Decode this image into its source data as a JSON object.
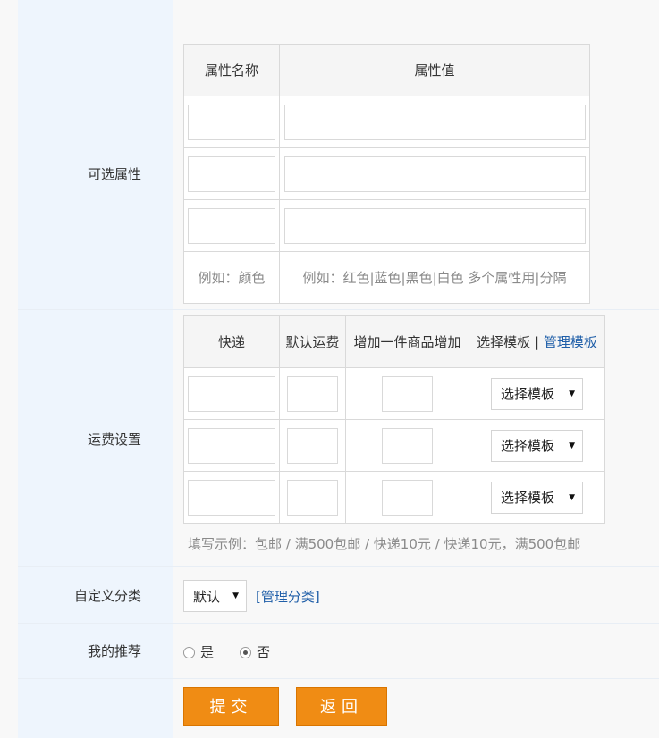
{
  "attributes": {
    "label": "可选属性",
    "header_name": "属性名称",
    "header_value": "属性值",
    "rows": [
      {
        "name": "",
        "value": ""
      },
      {
        "name": "",
        "value": ""
      },
      {
        "name": "",
        "value": ""
      }
    ],
    "example_name": "例如：颜色",
    "example_value": "例如：红色|蓝色|黑色|白色 多个属性用|分隔"
  },
  "shipping": {
    "label": "运费设置",
    "header_courier": "快递",
    "header_default_fee": "默认运费",
    "header_extra_fee": "增加一件商品增加",
    "header_template": "选择模板",
    "header_separator": "|",
    "header_manage_link": "管理模板",
    "template_select_value": "选择模板",
    "rows": [
      {
        "courier": "",
        "default_fee": "",
        "extra_fee": "",
        "template": "选择模板"
      },
      {
        "courier": "",
        "default_fee": "",
        "extra_fee": "",
        "template": "选择模板"
      },
      {
        "courier": "",
        "default_fee": "",
        "extra_fee": "",
        "template": "选择模板"
      }
    ],
    "example": "填写示例：包邮 / 满500包邮 / 快递10元 / 快递10元，满500包邮"
  },
  "category": {
    "label": "自定义分类",
    "selected": "默认",
    "manage_link": "[管理分类]"
  },
  "recommend": {
    "label": "我的推荐",
    "options": [
      "是",
      "否"
    ],
    "selected": "否"
  },
  "actions": {
    "submit": "提交",
    "back": "返回"
  },
  "colors": {
    "label_bg": "#eef5fd",
    "button_bg": "#f08c14",
    "link": "#1f5ea8"
  }
}
